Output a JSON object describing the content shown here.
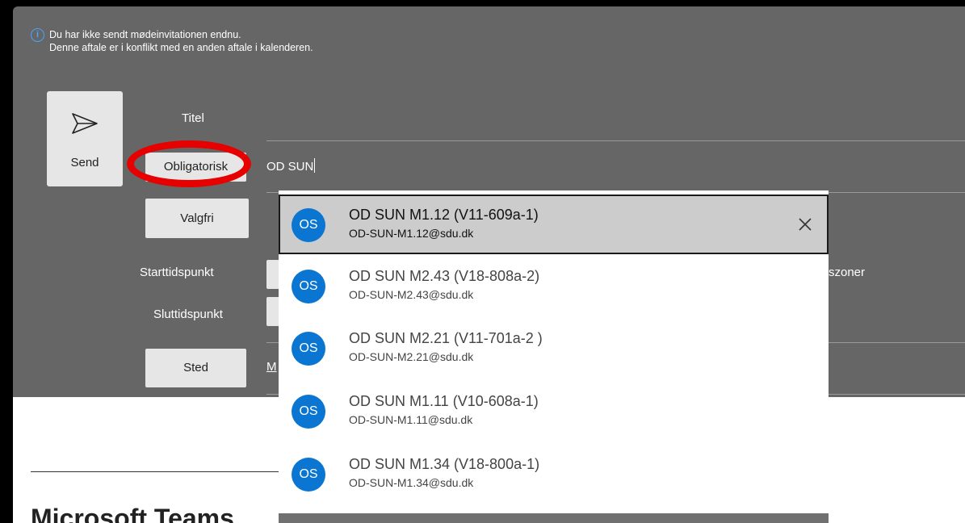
{
  "notice": {
    "line1": "Du har ikke sendt mødeinvitationen endnu.",
    "line2": "Denne aftale er i konflikt med en anden aftale i kalenderen.",
    "icon": "info-icon"
  },
  "send": {
    "label": "Send",
    "icon": "send-icon"
  },
  "form": {
    "title_label": "Titel",
    "required_button": "Obligatorisk",
    "required_value": "OD SUN",
    "optional_button": "Valgfri",
    "start_label": "Starttidspunkt",
    "end_label": "Sluttidspunkt",
    "location_button": "Sted",
    "location_link_partial": "M",
    "timezone_partial": "szoner"
  },
  "suggestions": [
    {
      "initials": "OS",
      "name": "OD SUN M1.12 (V11-609a-1)",
      "email": "OD-SUN-M1.12@sdu.dk",
      "selected": true
    },
    {
      "initials": "OS",
      "name": "OD SUN M2.43 (V18-808a-2)",
      "email": "OD-SUN-M2.43@sdu.dk",
      "selected": false
    },
    {
      "initials": "OS",
      "name": "OD SUN M2.21 (V11-701a-2 )",
      "email": "OD-SUN-M2.21@sdu.dk",
      "selected": false
    },
    {
      "initials": "OS",
      "name": "OD SUN M1.11 (V10-608a-1)",
      "email": "OD-SUN-M1.11@sdu.dk",
      "selected": false
    },
    {
      "initials": "OS",
      "name": "OD SUN M1.34 (V18-800a-1)",
      "email": "OD-SUN-M1.34@sdu.dk",
      "selected": false
    }
  ],
  "body": {
    "title_partial": "Microsoft Teams"
  },
  "colors": {
    "window_bg": "#666666",
    "avatar_bg": "#0a76d1",
    "highlight_ring": "#e60000",
    "info": "#4aa3ff"
  }
}
